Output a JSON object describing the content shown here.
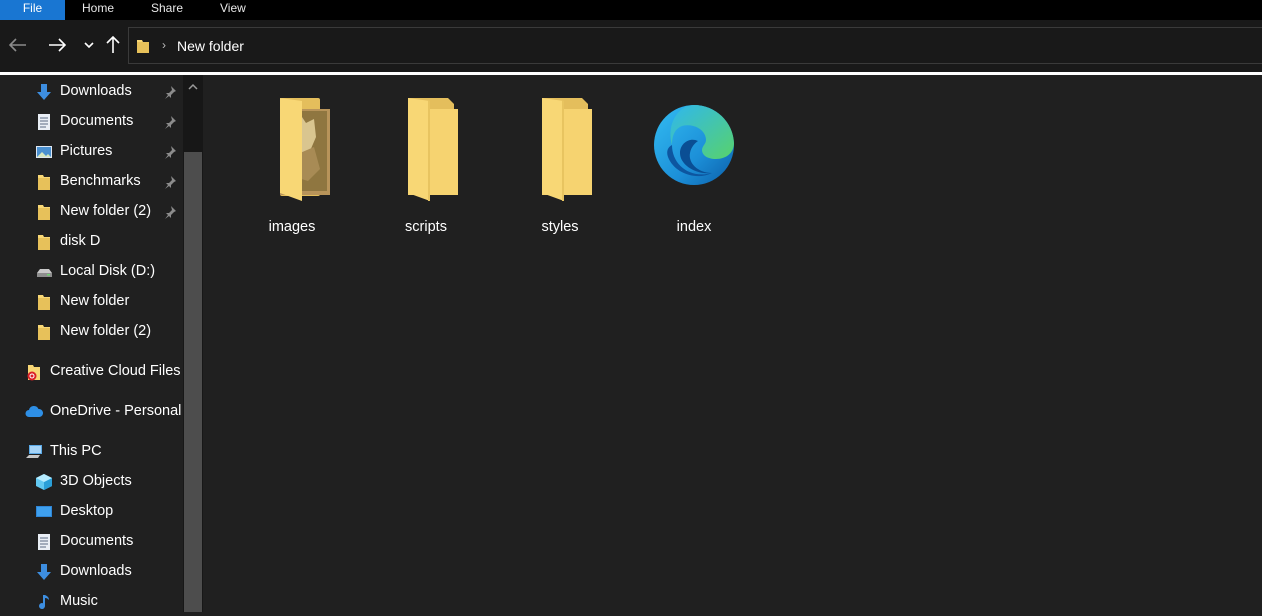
{
  "ribbon": {
    "tabs": [
      "File",
      "Home",
      "Share",
      "View"
    ]
  },
  "address": {
    "path": "New folder"
  },
  "sidebar": {
    "items": [
      {
        "label": "Downloads",
        "icon": "download-arrow-icon",
        "pinned": true
      },
      {
        "label": "Documents",
        "icon": "document-icon",
        "pinned": true
      },
      {
        "label": "Pictures",
        "icon": "pictures-icon",
        "pinned": true
      },
      {
        "label": "Benchmarks",
        "icon": "folder-icon",
        "pinned": true
      },
      {
        "label": "New folder (2)",
        "icon": "folder-icon",
        "pinned": true
      },
      {
        "label": "disk D",
        "icon": "folder-icon",
        "pinned": false
      },
      {
        "label": "Local Disk (D:)",
        "icon": "drive-icon",
        "pinned": false
      },
      {
        "label": "New folder",
        "icon": "folder-icon",
        "pinned": false
      },
      {
        "label": "New folder (2)",
        "icon": "folder-icon",
        "pinned": false
      },
      {
        "label": "Creative Cloud Files",
        "icon": "creative-cloud-icon",
        "pinned": false
      },
      {
        "label": "OneDrive - Personal",
        "icon": "onedrive-cloud-icon",
        "pinned": false
      },
      {
        "label": "This PC",
        "icon": "this-pc-icon",
        "pinned": false
      },
      {
        "label": "3D Objects",
        "icon": "3d-objects-icon",
        "pinned": false
      },
      {
        "label": "Desktop",
        "icon": "desktop-icon",
        "pinned": false
      },
      {
        "label": "Documents",
        "icon": "document-icon",
        "pinned": false
      },
      {
        "label": "Downloads",
        "icon": "download-arrow-icon",
        "pinned": false
      },
      {
        "label": "Music",
        "icon": "music-note-icon",
        "pinned": false
      }
    ]
  },
  "files": [
    {
      "name": "images",
      "icon": "folder-with-image-icon"
    },
    {
      "name": "scripts",
      "icon": "folder-icon"
    },
    {
      "name": "styles",
      "icon": "folder-icon"
    },
    {
      "name": "index",
      "icon": "edge-browser-icon"
    }
  ],
  "colors": {
    "background": "#202020",
    "file_tab": "#1976d2",
    "folder": "#f8d775",
    "folder_dark": "#e0b84b"
  }
}
